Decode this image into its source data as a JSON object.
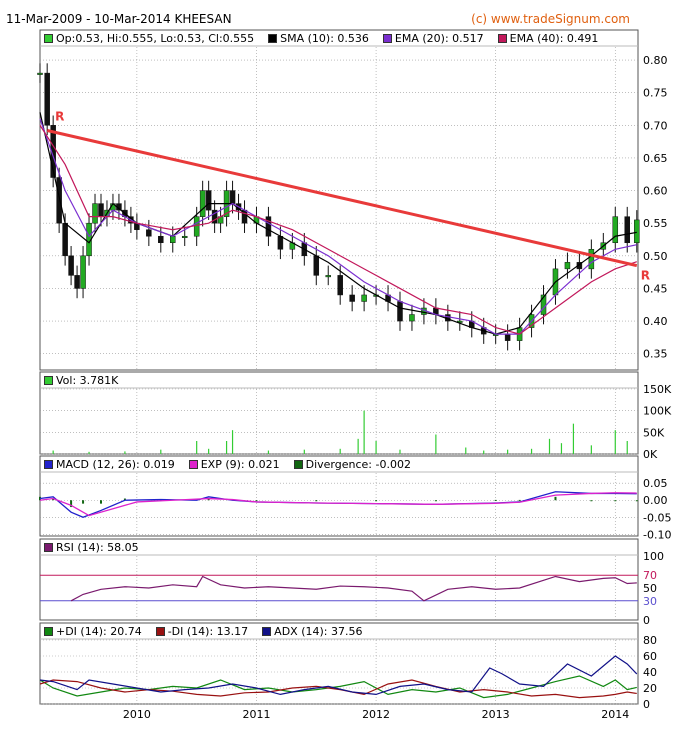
{
  "header": {
    "date_range": "11-Mar-2009 - 10-Mar-2014 KHEESAN",
    "source": "(c) www.tradeSignum.com"
  },
  "colors": {
    "price": "#22aa22",
    "sma": "#000000",
    "ema20": "#7b2fd0",
    "ema40": "#c2185b",
    "trendline": "#e83a3a",
    "volume": "#33cc33",
    "macd": "#2222cc",
    "exp": "#dd22cc",
    "divergence": "#116611",
    "rsi": "#7a1a6e",
    "pdi": "#118811",
    "mdi": "#991111",
    "adx": "#111188",
    "grid": "#999999"
  },
  "legends": {
    "price": [
      {
        "label": "Op:0.53, Hi:0.555, Lo:0.53, Cl:0.555",
        "color": "#33cc33"
      },
      {
        "label": "SMA (10): 0.536",
        "color": "#000000"
      },
      {
        "label": "EMA (20): 0.517",
        "color": "#7b2fd0"
      },
      {
        "label": "EMA (40): 0.491",
        "color": "#c2185b"
      }
    ],
    "volume": [
      {
        "label": "Vol: 3.781K",
        "color": "#33cc33"
      }
    ],
    "macd": [
      {
        "label": "MACD (12, 26): 0.019",
        "color": "#2222cc"
      },
      {
        "label": "EXP (9): 0.021",
        "color": "#dd22cc"
      },
      {
        "label": "Divergence: -0.002",
        "color": "#116611"
      }
    ],
    "rsi": [
      {
        "label": "RSI (14): 58.05",
        "color": "#7a1a6e"
      }
    ],
    "dmi": [
      {
        "label": "+DI (14): 20.74",
        "color": "#118811"
      },
      {
        "label": "-DI (14): 13.17",
        "color": "#991111"
      },
      {
        "label": "ADX (14): 37.56",
        "color": "#111188"
      }
    ]
  },
  "chart_data": [
    {
      "type": "candlestick",
      "panel": "price",
      "x_ticks": [
        "2010",
        "2011",
        "2012",
        "2013",
        "2014"
      ],
      "y_ticks": [
        "0.80",
        "0.75",
        "0.70",
        "0.65",
        "0.60",
        "0.55",
        "0.50",
        "0.45",
        "0.40",
        "0.35"
      ],
      "ylim": [
        0.325,
        0.82
      ],
      "trendline": {
        "label_start": "R",
        "label_end": "R",
        "from": [
          2009.25,
          0.692
        ],
        "to": [
          2014.18,
          0.485
        ]
      },
      "series": [
        {
          "name": "Close",
          "x": [
            2009.19,
            2009.25,
            2009.3,
            2009.35,
            2009.4,
            2009.45,
            2009.5,
            2009.55,
            2009.6,
            2009.65,
            2009.7,
            2009.75,
            2009.8,
            2009.85,
            2009.9,
            2009.95,
            2010.0,
            2010.1,
            2010.2,
            2010.3,
            2010.4,
            2010.5,
            2010.55,
            2010.6,
            2010.65,
            2010.7,
            2010.75,
            2010.8,
            2010.85,
            2010.9,
            2011.0,
            2011.1,
            2011.2,
            2011.3,
            2011.4,
            2011.5,
            2011.6,
            2011.7,
            2011.8,
            2011.9,
            2012.0,
            2012.1,
            2012.2,
            2012.3,
            2012.4,
            2012.5,
            2012.6,
            2012.7,
            2012.8,
            2012.9,
            2013.0,
            2013.1,
            2013.2,
            2013.3,
            2013.4,
            2013.5,
            2013.6,
            2013.7,
            2013.8,
            2013.9,
            2014.0,
            2014.1,
            2014.18
          ],
          "values": [
            0.78,
            0.7,
            0.62,
            0.55,
            0.5,
            0.47,
            0.45,
            0.5,
            0.55,
            0.58,
            0.56,
            0.57,
            0.58,
            0.57,
            0.56,
            0.55,
            0.54,
            0.53,
            0.52,
            0.53,
            0.53,
            0.56,
            0.6,
            0.57,
            0.55,
            0.56,
            0.6,
            0.58,
            0.57,
            0.55,
            0.56,
            0.53,
            0.51,
            0.52,
            0.5,
            0.47,
            0.47,
            0.44,
            0.43,
            0.44,
            0.44,
            0.43,
            0.4,
            0.41,
            0.42,
            0.41,
            0.4,
            0.4,
            0.39,
            0.38,
            0.38,
            0.37,
            0.39,
            0.41,
            0.44,
            0.48,
            0.49,
            0.48,
            0.51,
            0.52,
            0.56,
            0.52,
            0.555
          ]
        },
        {
          "name": "SMA (10)",
          "x": [
            2009.19,
            2009.4,
            2009.6,
            2009.8,
            2010.0,
            2010.3,
            2010.6,
            2010.8,
            2011.0,
            2011.3,
            2011.6,
            2011.9,
            2012.2,
            2012.5,
            2012.8,
            2013.0,
            2013.2,
            2013.5,
            2013.8,
            2014.0,
            2014.18
          ],
          "values": [
            0.72,
            0.55,
            0.52,
            0.58,
            0.55,
            0.53,
            0.58,
            0.58,
            0.55,
            0.52,
            0.49,
            0.45,
            0.42,
            0.41,
            0.39,
            0.38,
            0.39,
            0.46,
            0.5,
            0.53,
            0.536
          ]
        },
        {
          "name": "EMA (20)",
          "x": [
            2009.19,
            2009.4,
            2009.6,
            2009.8,
            2010.0,
            2010.3,
            2010.6,
            2010.8,
            2011.0,
            2011.3,
            2011.6,
            2011.9,
            2012.2,
            2012.5,
            2012.8,
            2013.0,
            2013.2,
            2013.5,
            2013.8,
            2014.0,
            2014.18
          ],
          "values": [
            0.71,
            0.6,
            0.53,
            0.57,
            0.55,
            0.53,
            0.56,
            0.58,
            0.56,
            0.53,
            0.5,
            0.46,
            0.43,
            0.41,
            0.4,
            0.38,
            0.38,
            0.44,
            0.49,
            0.51,
            0.517
          ]
        },
        {
          "name": "EMA (40)",
          "x": [
            2009.19,
            2009.4,
            2009.6,
            2009.8,
            2010.0,
            2010.3,
            2010.6,
            2010.8,
            2011.0,
            2011.3,
            2011.6,
            2011.9,
            2012.2,
            2012.5,
            2012.8,
            2013.0,
            2013.2,
            2013.5,
            2013.8,
            2014.0,
            2014.18
          ],
          "values": [
            0.7,
            0.64,
            0.56,
            0.56,
            0.55,
            0.54,
            0.55,
            0.57,
            0.56,
            0.54,
            0.51,
            0.48,
            0.45,
            0.42,
            0.41,
            0.39,
            0.38,
            0.42,
            0.46,
            0.48,
            0.491
          ]
        }
      ]
    },
    {
      "type": "bar",
      "panel": "volume",
      "y_ticks": [
        "150K",
        "100K",
        "50K",
        "0K"
      ],
      "ylim": [
        0,
        150000
      ],
      "x": [
        2009.3,
        2009.6,
        2009.9,
        2010.2,
        2010.5,
        2010.6,
        2010.75,
        2010.8,
        2011.1,
        2011.4,
        2011.7,
        2011.85,
        2011.9,
        2012.0,
        2012.2,
        2012.5,
        2012.75,
        2012.9,
        2013.1,
        2013.3,
        2013.45,
        2013.55,
        2013.65,
        2013.8,
        2014.0,
        2014.1
      ],
      "values": [
        8000,
        5000,
        6000,
        10000,
        30000,
        12000,
        30000,
        55000,
        8000,
        10000,
        12000,
        35000,
        100000,
        30000,
        10000,
        45000,
        15000,
        8000,
        10000,
        12000,
        35000,
        25000,
        70000,
        20000,
        55000,
        30000
      ]
    },
    {
      "type": "line",
      "panel": "macd",
      "y_ticks": [
        "0.05",
        "0.00",
        "-0.05",
        "-0.10"
      ],
      "ylim": [
        -0.105,
        0.08
      ],
      "series": [
        {
          "name": "MACD (12, 26)",
          "x": [
            2009.19,
            2009.3,
            2009.45,
            2009.55,
            2009.7,
            2009.9,
            2010.2,
            2010.5,
            2010.6,
            2010.8,
            2011.0,
            2011.5,
            2012.0,
            2012.5,
            2013.0,
            2013.2,
            2013.5,
            2013.8,
            2014.0,
            2014.18
          ],
          "values": [
            0.005,
            0.01,
            -0.035,
            -0.05,
            -0.03,
            0.0,
            0.002,
            0.0,
            0.01,
            0.0,
            -0.005,
            -0.008,
            -0.01,
            -0.012,
            -0.008,
            -0.005,
            0.025,
            0.02,
            0.02,
            0.019
          ]
        },
        {
          "name": "EXP (9)",
          "x": [
            2009.19,
            2009.3,
            2009.45,
            2009.6,
            2009.8,
            2010.0,
            2010.3,
            2010.6,
            2010.8,
            2011.0,
            2011.5,
            2012.0,
            2012.5,
            2013.0,
            2013.2,
            2013.5,
            2013.8,
            2014.0,
            2014.18
          ],
          "values": [
            0.0,
            0.005,
            -0.015,
            -0.045,
            -0.025,
            -0.005,
            0.0,
            0.005,
            0.002,
            -0.005,
            -0.008,
            -0.01,
            -0.012,
            -0.009,
            -0.006,
            0.015,
            0.02,
            0.022,
            0.021
          ]
        },
        {
          "name": "Divergence",
          "x": [
            2009.19,
            2009.3,
            2009.45,
            2009.55,
            2009.7,
            2009.9,
            2010.2,
            2010.6,
            2011.0,
            2011.5,
            2012.0,
            2012.5,
            2013.0,
            2013.2,
            2013.5,
            2013.8,
            2014.0,
            2014.18
          ],
          "values": [
            0.01,
            0.005,
            -0.02,
            -0.01,
            -0.01,
            0.005,
            0.002,
            0.005,
            0.0,
            0.0,
            0.0,
            0.0,
            0.001,
            0.001,
            0.01,
            0.0,
            -0.002,
            -0.002
          ]
        }
      ]
    },
    {
      "type": "line",
      "panel": "rsi",
      "y_ticks": [
        "100",
        "70",
        "50",
        "30",
        "0"
      ],
      "ylim": [
        0,
        100
      ],
      "series": [
        {
          "name": "RSI (14)",
          "x": [
            2009.45,
            2009.55,
            2009.7,
            2009.9,
            2010.1,
            2010.3,
            2010.5,
            2010.55,
            2010.7,
            2010.9,
            2011.1,
            2011.3,
            2011.5,
            2011.7,
            2011.9,
            2012.1,
            2012.3,
            2012.4,
            2012.6,
            2012.8,
            2013.0,
            2013.2,
            2013.4,
            2013.5,
            2013.7,
            2013.9,
            2014.0,
            2014.1,
            2014.18
          ],
          "values": [
            30,
            40,
            48,
            52,
            50,
            55,
            52,
            68,
            55,
            50,
            52,
            50,
            48,
            53,
            52,
            50,
            45,
            30,
            48,
            52,
            48,
            50,
            62,
            68,
            60,
            65,
            66,
            57,
            58
          ]
        }
      ]
    },
    {
      "type": "line",
      "panel": "dmi",
      "y_ticks": [
        "80",
        "60",
        "40",
        "20",
        "0"
      ],
      "ylim": [
        0,
        80
      ],
      "series": [
        {
          "name": "+DI (14)",
          "x": [
            2009.19,
            2009.3,
            2009.5,
            2009.7,
            2009.9,
            2010.1,
            2010.3,
            2010.5,
            2010.7,
            2010.9,
            2011.1,
            2011.3,
            2011.5,
            2011.7,
            2011.9,
            2012.1,
            2012.3,
            2012.5,
            2012.7,
            2012.9,
            2013.1,
            2013.3,
            2013.5,
            2013.7,
            2013.9,
            2014.0,
            2014.1,
            2014.18
          ],
          "values": [
            30,
            20,
            10,
            15,
            20,
            18,
            22,
            20,
            30,
            18,
            20,
            15,
            18,
            22,
            28,
            12,
            18,
            15,
            20,
            8,
            12,
            20,
            28,
            35,
            22,
            30,
            18,
            20.74
          ]
        },
        {
          "name": "-DI (14)",
          "x": [
            2009.19,
            2009.3,
            2009.5,
            2009.7,
            2009.9,
            2010.1,
            2010.3,
            2010.5,
            2010.7,
            2010.9,
            2011.1,
            2011.3,
            2011.5,
            2011.7,
            2011.9,
            2012.1,
            2012.3,
            2012.5,
            2012.7,
            2012.9,
            2013.1,
            2013.3,
            2013.5,
            2013.7,
            2013.9,
            2014.0,
            2014.1,
            2014.18
          ],
          "values": [
            25,
            30,
            28,
            20,
            15,
            18,
            16,
            12,
            10,
            14,
            15,
            20,
            22,
            18,
            12,
            25,
            30,
            22,
            15,
            18,
            15,
            10,
            12,
            8,
            10,
            12,
            15,
            13.17
          ]
        },
        {
          "name": "ADX (14)",
          "x": [
            2009.19,
            2009.3,
            2009.5,
            2009.6,
            2009.8,
            2010.0,
            2010.2,
            2010.4,
            2010.6,
            2010.8,
            2011.0,
            2011.2,
            2011.4,
            2011.6,
            2011.8,
            2012.0,
            2012.2,
            2012.4,
            2012.6,
            2012.8,
            2012.95,
            2013.05,
            2013.2,
            2013.4,
            2013.6,
            2013.8,
            2014.0,
            2014.1,
            2014.18
          ],
          "values": [
            30,
            28,
            18,
            30,
            25,
            20,
            15,
            18,
            20,
            25,
            20,
            12,
            18,
            22,
            15,
            12,
            22,
            25,
            18,
            15,
            45,
            38,
            25,
            22,
            50,
            35,
            60,
            50,
            37.56
          ]
        }
      ]
    }
  ]
}
